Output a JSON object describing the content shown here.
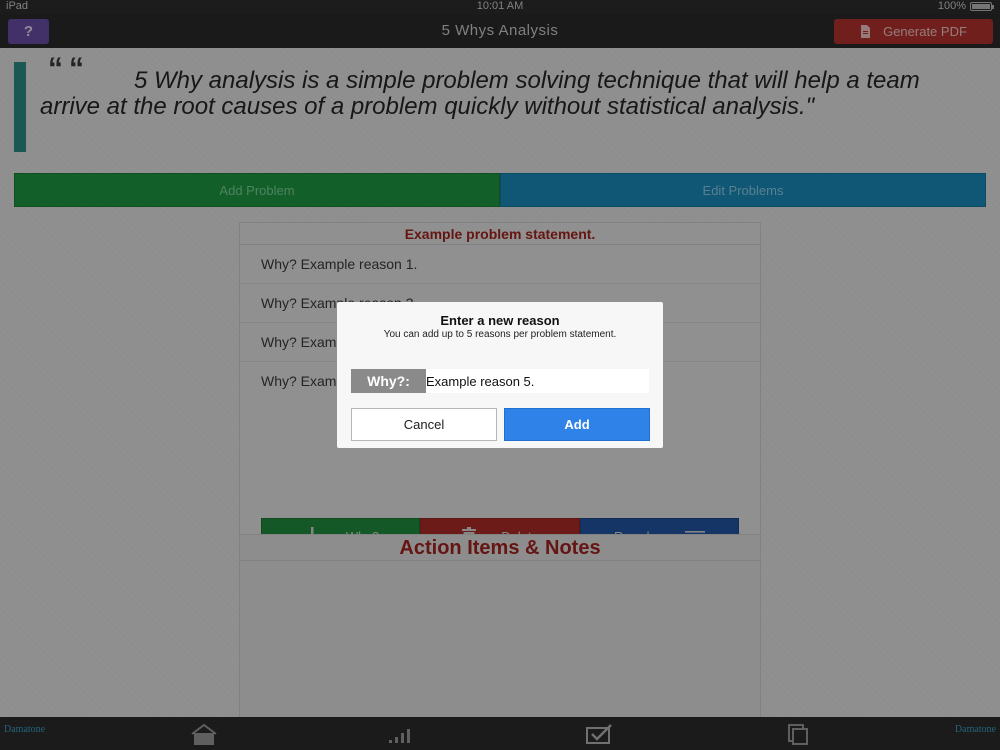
{
  "status_bar": {
    "carrier": "iPad",
    "time": "10:01 AM",
    "battery": "100%"
  },
  "nav": {
    "help_label": "?",
    "title": "5 Whys Analysis",
    "pdf_label": "Generate PDF"
  },
  "quote": {
    "mark": "““",
    "text": "5 Why analysis is a simple problem solving technique that will help a team arrive at the root causes of a problem quickly without statistical analysis.\""
  },
  "tabs": {
    "add_problem": "Add Problem",
    "edit_problems": "Edit Problems"
  },
  "problem": {
    "title": "Example problem statement.",
    "reasons": [
      "Why? Example reason 1.",
      "Why? Example reason 2.",
      "Why? Example reason 3.",
      "Why? Example reason 4."
    ],
    "actions": {
      "why": "Why?",
      "delete": "Delete",
      "reorder": "Reorder"
    }
  },
  "notes": {
    "title": "Action Items & Notes"
  },
  "dialog": {
    "title": "Enter a new reason",
    "subtitle": "You can add up to 5 reasons per problem statement.",
    "why_label": "Why?:",
    "input_value": "Example reason 5.",
    "cancel": "Cancel",
    "add": "Add"
  },
  "bottom_bar": {
    "logo": "Damatone"
  },
  "colors": {
    "accent_teal": "#2e8e86",
    "green": "#1f9a43",
    "blue": "#1a8bbd",
    "red": "#b5332f",
    "purple": "#6b4fa8",
    "dialog_add": "#2f82e8"
  }
}
